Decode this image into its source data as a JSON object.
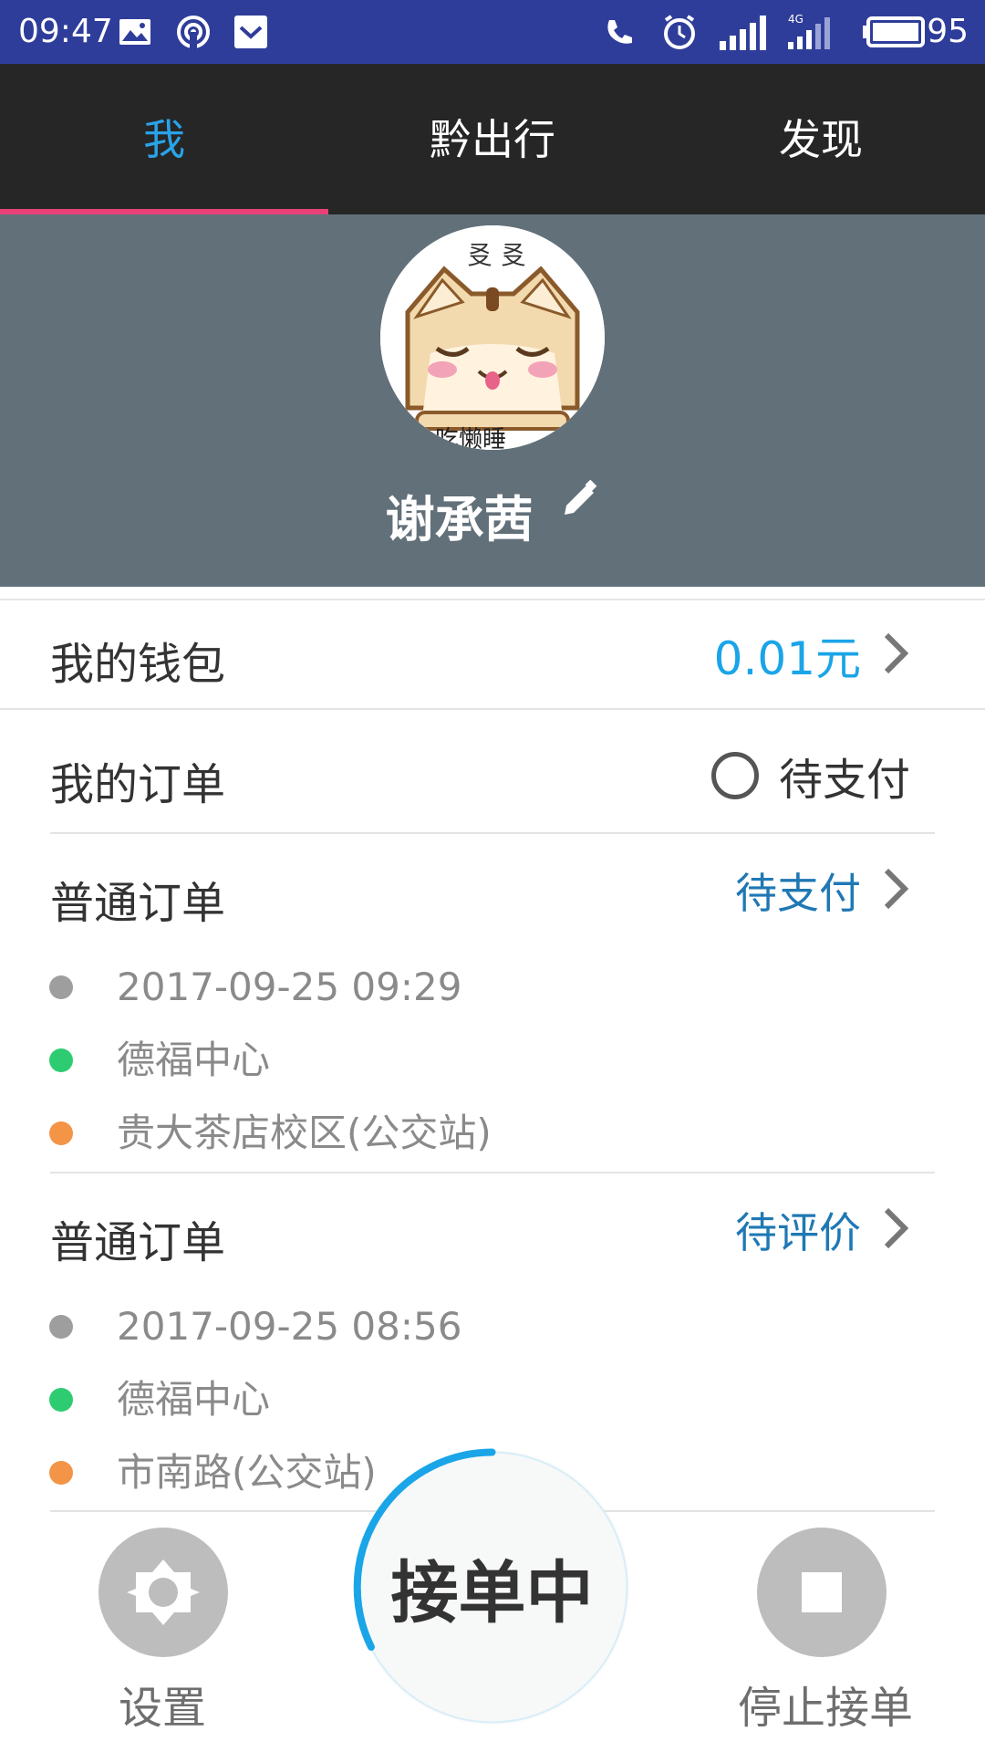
{
  "status_bar": {
    "time": "09:47",
    "battery": "95",
    "network": "4G"
  },
  "tabs": [
    {
      "label": "我",
      "active": true
    },
    {
      "label": "黔出行",
      "active": false
    },
    {
      "label": "发现",
      "active": false
    }
  ],
  "profile": {
    "name": "谢承茜",
    "avatar_text": "吃懒睡"
  },
  "wallet": {
    "label": "我的钱包",
    "value": "0.01元"
  },
  "orders": {
    "label": "我的订单",
    "filter_label": "待支付"
  },
  "order_list": [
    {
      "type": "普通订单",
      "status": "待支付",
      "time": "2017-09-25 09:29",
      "start": "德福中心",
      "end": "贵大茶店校区(公交站)"
    },
    {
      "type": "普通订单",
      "status": "待评价",
      "time": "2017-09-25 08:56",
      "start": "德福中心",
      "end": "市南路(公交站)"
    }
  ],
  "bottom": {
    "settings_label": "设置",
    "accepting_label": "接单中",
    "stop_label": "停止接单"
  },
  "colors": {
    "status_bar": "#2f3d9a",
    "tab_bar": "#262626",
    "tab_active": "#29a3e8",
    "tab_indicator": "#e9407a",
    "profile_bg": "#627079",
    "dot_time": "#9e9e9e",
    "dot_start": "#2ecc71",
    "dot_end": "#f39447"
  }
}
